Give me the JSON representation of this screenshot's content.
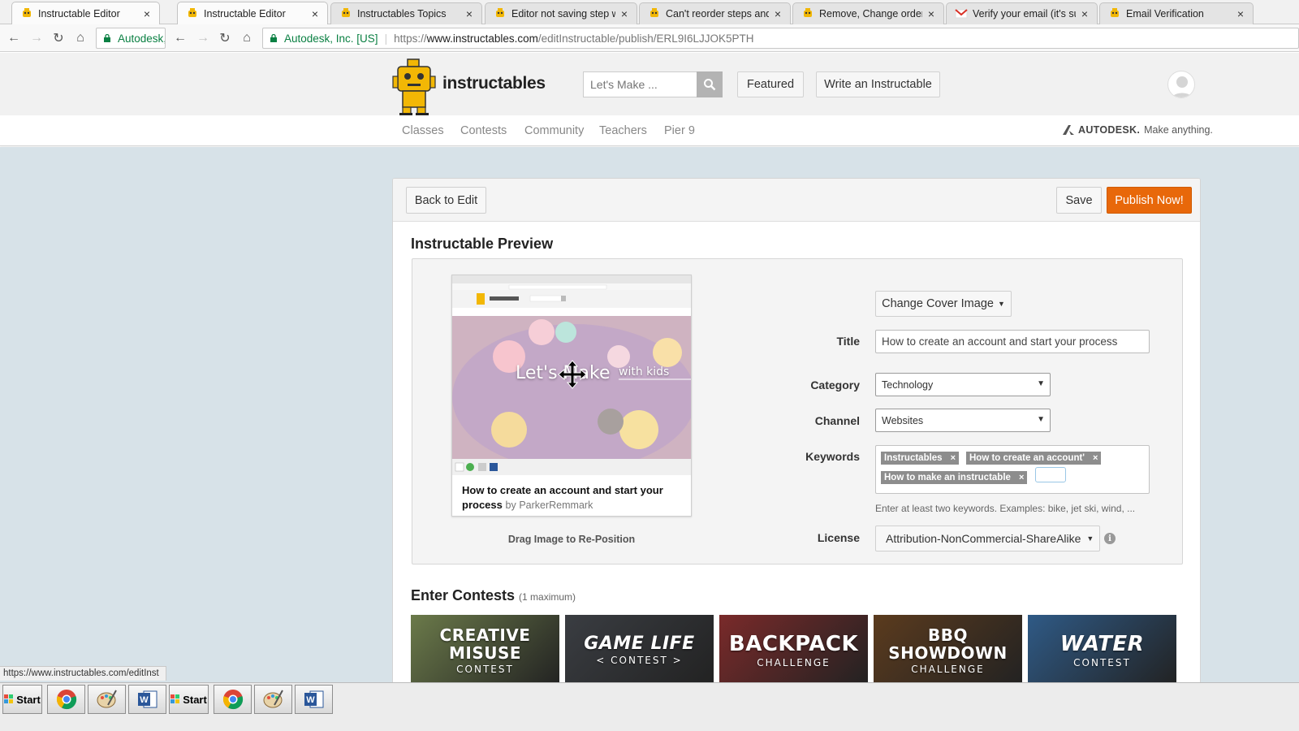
{
  "browser": {
    "tabs": [
      {
        "title": "Instructable Editor",
        "favicon": "instructables-robot-icon",
        "active": true
      },
      {
        "title": "Instructable Editor",
        "favicon": "instructables-robot-icon",
        "active": true
      },
      {
        "title": "Instructables Topics",
        "favicon": "instructables-robot-icon"
      },
      {
        "title": "Editor not saving step wh",
        "favicon": "instructables-robot-icon"
      },
      {
        "title": "Can't reorder steps and p",
        "favicon": "instructables-robot-icon"
      },
      {
        "title": "Remove, Change order of",
        "favicon": "instructables-robot-icon"
      },
      {
        "title": "Verify your email (it's sup",
        "favicon": "gmail-icon"
      },
      {
        "title": "Email Verification",
        "favicon": "instructables-robot-icon"
      }
    ],
    "left_omnibox_org": "Autodesk,",
    "omnibox": {
      "org": "Autodesk, Inc. [US]",
      "url_scheme": "https://",
      "url_host": "www.instructables.com",
      "url_path": "/editInstructable/publish/ERL9I6LJJOK5PTH"
    },
    "status_url": "https://www.instructables.com/editInst"
  },
  "site": {
    "logo_text": "instructables",
    "search_placeholder": "Let's Make ...",
    "featured_label": "Featured",
    "write_label": "Write an Instructable",
    "nav": [
      "Classes",
      "Contests",
      "Community",
      "Teachers",
      "Pier 9"
    ],
    "autodesk_brand": "AUTODESK.",
    "autodesk_tagline": "Make anything."
  },
  "editor": {
    "back_label": "Back to Edit",
    "save_label": "Save",
    "publish_label": "Publish Now!",
    "preview_heading": "Instructable Preview",
    "cover_overlay_1": "Let's Make",
    "cover_overlay_2": "with kids",
    "card_title": "How to create an account and start your process",
    "card_by": "by",
    "card_author": "ParkerRemmark",
    "drag_hint": "Drag Image to Re-Position",
    "change_cover_label": "Change Cover Image",
    "title_label": "Title",
    "title_value": "How to create an account and start your process",
    "category_label": "Category",
    "category_value": "Technology",
    "channel_label": "Channel",
    "channel_value": "Websites",
    "keywords_label": "Keywords",
    "keywords": [
      "Instructables",
      "How to create an account'",
      "How to make an instructable"
    ],
    "keywords_help": "Enter at least two keywords. Examples: bike, jet ski, wind, ...",
    "license_label": "License",
    "license_value": "Attribution-NonCommercial-ShareAlike",
    "contests_heading": "Enter Contests",
    "contests_note": "(1 maximum)",
    "contests": [
      {
        "line1": "CREATIVE MISUSE",
        "line2": "CONTEST",
        "color": "#6b7a4a"
      },
      {
        "line1": "GAME LIFE",
        "line2": "< CONTEST >",
        "color": "#3a3d42"
      },
      {
        "line1": "BACKPACK",
        "line2": "CHALLENGE",
        "color": "#7a2a2a"
      },
      {
        "line1": "BBQ SHOWDOWN",
        "line2": "CHALLENGE",
        "color": "#5b3b1e"
      },
      {
        "line1": "WATER",
        "line2": "CONTEST",
        "color": "#2f5a86"
      }
    ]
  },
  "taskbar": {
    "items": [
      "Start",
      "chrome-icon",
      "paint-icon",
      "word-icon",
      "Start",
      "chrome-icon",
      "paint-icon",
      "word-icon"
    ]
  },
  "colors": {
    "accent_orange": "#e8680a",
    "page_bg": "#d7e2e8",
    "secure_green": "#0b8043"
  }
}
